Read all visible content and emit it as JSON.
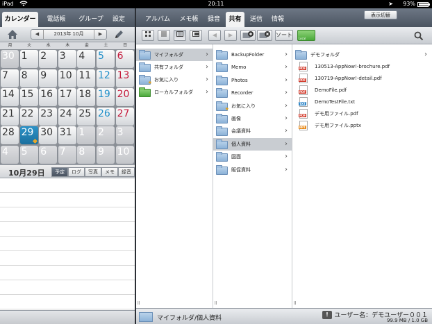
{
  "status": {
    "device": "iPad",
    "time": "20:11",
    "battery": "93%",
    "battery_level": 0.93
  },
  "tabs": {
    "left": [
      "カレンダー",
      "電話帳",
      "グループ",
      "設定"
    ],
    "right": [
      "アルバム",
      "メモ帳",
      "録音",
      "共有",
      "送信",
      "情報"
    ],
    "active_left": "カレンダー",
    "active_right": "共有"
  },
  "switch_button": "表示切替",
  "calendar": {
    "month_label": "2013年 10月",
    "weekdays": [
      "月",
      "火",
      "水",
      "木",
      "金",
      "土",
      "日"
    ],
    "weeks": [
      [
        "30",
        "1",
        "2",
        "3",
        "4",
        "5",
        "6"
      ],
      [
        "7",
        "8",
        "9",
        "10",
        "11",
        "12",
        "13"
      ],
      [
        "14",
        "15",
        "16",
        "17",
        "18",
        "19",
        "20"
      ],
      [
        "21",
        "22",
        "23",
        "24",
        "25",
        "26",
        "27"
      ],
      [
        "28",
        "29",
        "30",
        "31",
        "1",
        "2",
        "3"
      ],
      [
        "4",
        "5",
        "6",
        "7",
        "8",
        "9",
        "10"
      ]
    ],
    "selected_date": "10月29日",
    "view_tabs": [
      "予定",
      "ログ",
      "写真",
      "メモ",
      "録音"
    ],
    "active_view": "予定"
  },
  "toolbar": {
    "sort_label": "ソート",
    "local_label": "Local"
  },
  "columns": {
    "col1": [
      {
        "label": "マイフォルダ",
        "icon": "folder-icon",
        "selected": true
      },
      {
        "label": "共有フォルダ",
        "icon": "folder-icon",
        "selected": false
      },
      {
        "label": "お気に入り",
        "icon": "folder-star-icon",
        "selected": false
      },
      {
        "label": "ローカルフォルダ",
        "icon": "local-folder-icon",
        "selected": false
      }
    ],
    "col2": [
      {
        "label": "BackupFolder",
        "selected": false,
        "star": false
      },
      {
        "label": "Memo",
        "selected": false,
        "star": false
      },
      {
        "label": "Photos",
        "selected": false,
        "star": false
      },
      {
        "label": "Recorder",
        "selected": false,
        "star": false
      },
      {
        "label": "お気に入り",
        "selected": false,
        "star": true
      },
      {
        "label": "画像",
        "selected": false,
        "star": false
      },
      {
        "label": "会議資料",
        "selected": false,
        "star": false
      },
      {
        "label": "個人資料",
        "selected": true,
        "star": false
      },
      {
        "label": "図面",
        "selected": false,
        "star": false
      },
      {
        "label": "販促資料",
        "selected": false,
        "star": false
      }
    ],
    "col3": [
      {
        "label": "デモフォルダ",
        "type": "folder"
      },
      {
        "label": "130513-AppNow!-brochure.pdf",
        "type": "PDF"
      },
      {
        "label": "130719-AppNow!-detail.pdf",
        "type": "PDF"
      },
      {
        "label": "DemoFile.pdf",
        "type": "PDF"
      },
      {
        "label": "DemoTestFile.txt",
        "type": "TXT"
      },
      {
        "label": "デモ用ファイル.pdf",
        "type": "PDF"
      },
      {
        "label": "デモ用ファイル.pptx",
        "type": "PPT"
      }
    ]
  },
  "footer": {
    "path": "マイフォルダ/個人資料",
    "user": "ユーザー名：デモユーザー００１",
    "usage": "99.9 MB / 1.0 GB"
  },
  "colors": {
    "accent": "#1f8fc9",
    "sunday": "#c4183a",
    "saturday": "#1f8fc9",
    "today": "#2c93c8"
  }
}
